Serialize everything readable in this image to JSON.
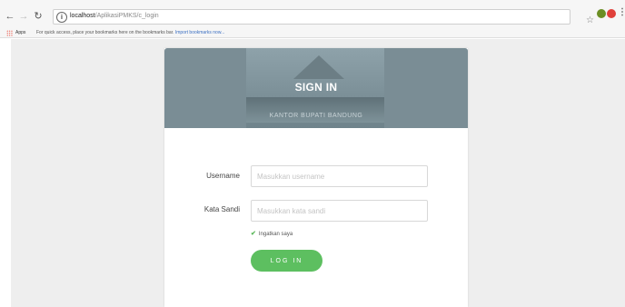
{
  "browser": {
    "url_host": "localhost",
    "url_path": "/AplikasiPMKS/c_login",
    "apps_label": "Apps",
    "bookmark_prompt": "For quick access, place your bookmarks here on the bookmarks bar.",
    "bookmark_link": "Import bookmarks now..."
  },
  "login": {
    "title": "SIGN IN",
    "banner_caption": "KANTOR BUPATI BANDUNG",
    "username_label": "Username",
    "username_placeholder": "Masukkan username",
    "password_label": "Kata Sandi",
    "password_placeholder": "Masukkan kata sandi",
    "remember_label": "Ingatkan saya",
    "remember_checked": true,
    "login_button": "LOG IN"
  },
  "colors": {
    "accent_green": "#5dbf60",
    "banner": "#7a8d95"
  }
}
